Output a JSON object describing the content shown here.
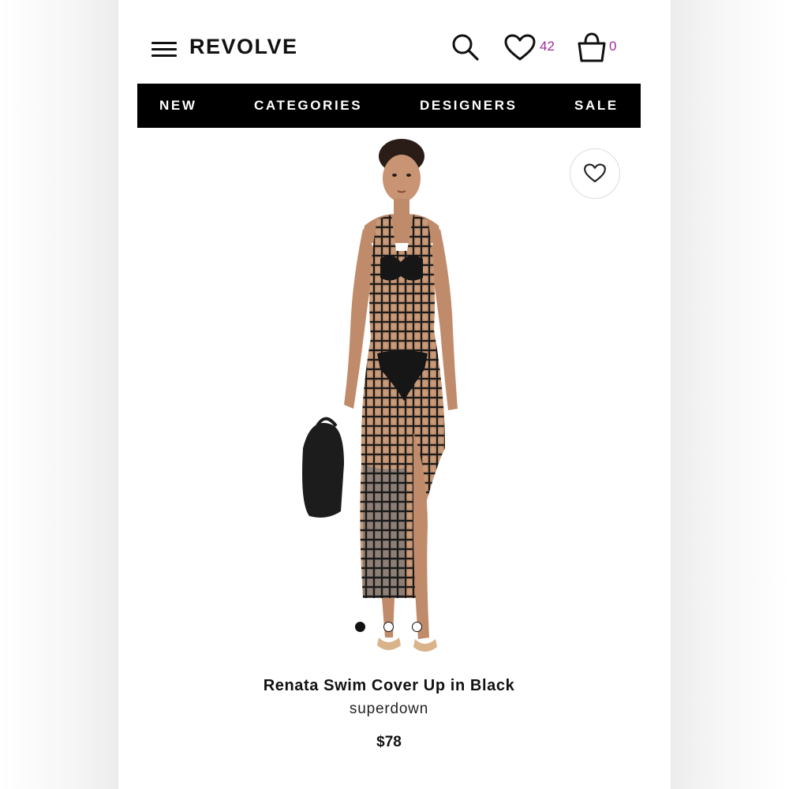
{
  "header": {
    "logo": "REVOLVE",
    "wishlist_count": "42",
    "bag_count": "0"
  },
  "nav": {
    "items": [
      {
        "label": "NEW"
      },
      {
        "label": "CATEGORIES"
      },
      {
        "label": "DESIGNERS"
      },
      {
        "label": "SALE"
      }
    ]
  },
  "product": {
    "name": "Renata Swim Cover Up in Black",
    "brand": "superdown",
    "price": "$78",
    "image_count": 3,
    "active_image": 1
  },
  "colors": {
    "nav_bg": "#000000",
    "badge": "#9b2c9b",
    "text": "#111111"
  },
  "icons": {
    "menu": "hamburger-icon",
    "search": "search-icon",
    "wishlist": "heart-icon",
    "bag": "shopping-bag-icon",
    "favorite": "heart-outline-icon"
  }
}
